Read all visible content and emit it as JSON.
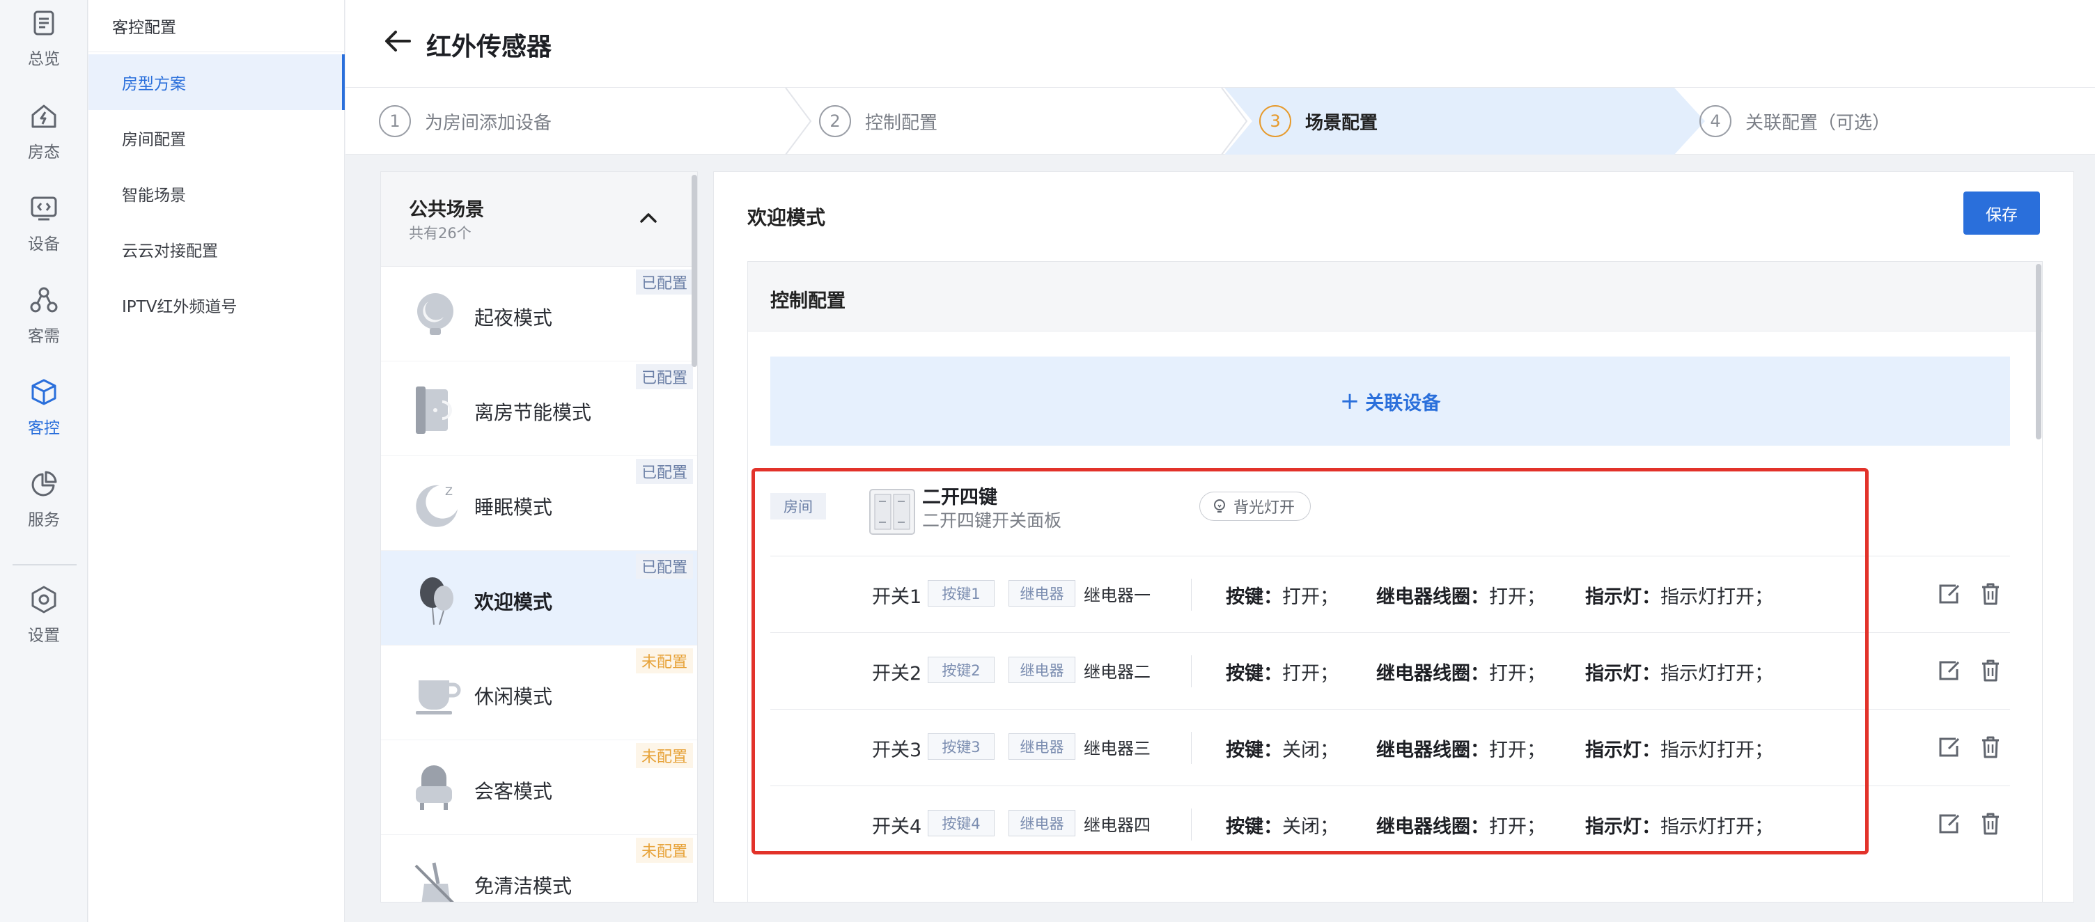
{
  "rail": [
    {
      "icon": "overview-icon",
      "label": "总览"
    },
    {
      "icon": "room-status-icon",
      "label": "房态"
    },
    {
      "icon": "device-icon",
      "label": "设备"
    },
    {
      "icon": "guest-needs-icon",
      "label": "客需"
    },
    {
      "icon": "guest-control-icon",
      "label": "客控"
    },
    {
      "icon": "service-icon",
      "label": "服务"
    },
    {
      "icon": "settings-icon",
      "label": "设置"
    }
  ],
  "subnav": {
    "title": "客控配置",
    "items": [
      "房型方案",
      "房间配置",
      "智能场景",
      "云云对接配置",
      "IPTV红外频道号"
    ]
  },
  "header": {
    "title": "红外传感器"
  },
  "steps": [
    {
      "num": "1",
      "label": "为房间添加设备"
    },
    {
      "num": "2",
      "label": "控制配置"
    },
    {
      "num": "3",
      "label": "场景配置"
    },
    {
      "num": "4",
      "label": "关联配置（可选）"
    }
  ],
  "scene_list": {
    "title": "公共场景",
    "count": "共有26个",
    "items": [
      {
        "name": "起夜模式",
        "status": "已配置",
        "icon": "night-light-icon"
      },
      {
        "name": "离房节能模式",
        "status": "已配置",
        "icon": "door-leave-icon"
      },
      {
        "name": "睡眠模式",
        "status": "已配置",
        "icon": "moon-sleep-icon"
      },
      {
        "name": "欢迎模式",
        "status": "已配置",
        "icon": "balloon-icon"
      },
      {
        "name": "休闲模式",
        "status": "未配置",
        "icon": "cup-icon"
      },
      {
        "name": "会客模式",
        "status": "未配置",
        "icon": "armchair-icon"
      },
      {
        "name": "免清洁模式",
        "status": "未配置",
        "icon": "no-clean-icon"
      }
    ]
  },
  "detail": {
    "title": "欢迎模式",
    "save_label": "保存",
    "control_title": "控制配置",
    "link_device": "关联设备",
    "device": {
      "room_tag": "房间",
      "name": "二开四键",
      "subtitle": "二开四键开关面板",
      "backlight": "背光灯开"
    },
    "rows": [
      {
        "switch": "开关1",
        "key": "按键1",
        "relay_tag": "继电器",
        "relay": "继电器一",
        "key_state_label": "按键：",
        "key_state": "打开；",
        "coil_label": "继电器线圈：",
        "coil": "打开；",
        "led_label": "指示灯：",
        "led": "指示灯打开；"
      },
      {
        "switch": "开关2",
        "key": "按键2",
        "relay_tag": "继电器",
        "relay": "继电器二",
        "key_state_label": "按键：",
        "key_state": "打开；",
        "coil_label": "继电器线圈：",
        "coil": "打开；",
        "led_label": "指示灯：",
        "led": "指示灯打开；"
      },
      {
        "switch": "开关3",
        "key": "按键3",
        "relay_tag": "继电器",
        "relay": "继电器三",
        "key_state_label": "按键：",
        "key_state": "关闭；",
        "coil_label": "继电器线圈：",
        "coil": "打开；",
        "led_label": "指示灯：",
        "led": "指示灯打开；"
      },
      {
        "switch": "开关4",
        "key": "按键4",
        "relay_tag": "继电器",
        "relay": "继电器四",
        "key_state_label": "按键：",
        "key_state": "关闭；",
        "coil_label": "继电器线圈：",
        "coil": "打开；",
        "led_label": "指示灯：",
        "led": "指示灯打开；"
      }
    ]
  },
  "colors": {
    "accent": "#2a6fdb",
    "step_active": "#e69a2c",
    "configured": "#6b7fa6",
    "unconfigured": "#e7a33a",
    "highlight": "#e2322a"
  }
}
